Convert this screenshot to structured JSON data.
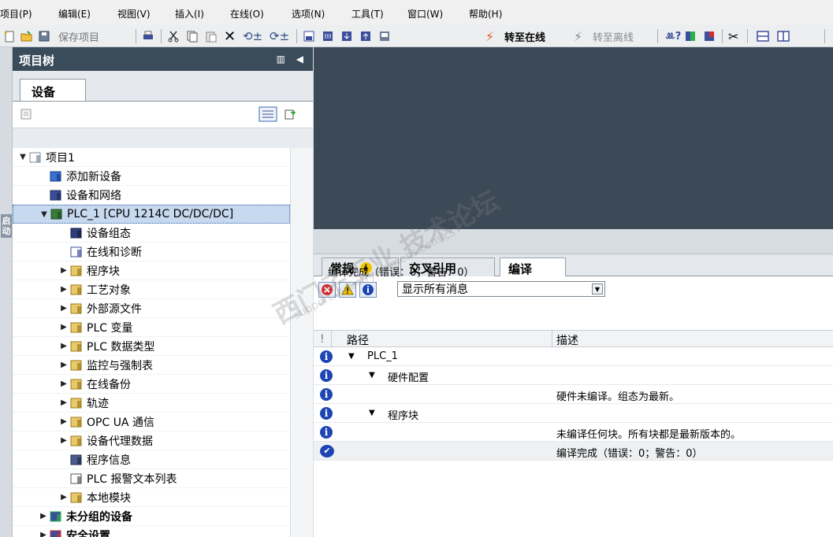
{
  "menu": [
    "项目(P)",
    "编辑(E)",
    "视图(V)",
    "插入(I)",
    "在线(O)",
    "选项(N)",
    "工具(T)",
    "窗口(W)",
    "帮助(H)"
  ],
  "toolbar": {
    "save_project": "保存项目",
    "go_online": "转至在线",
    "go_offline": "转至离线"
  },
  "left_strip_label": "启动",
  "project_tree": {
    "title": "项目树",
    "tab": "设备",
    "items": [
      {
        "label": "项目1",
        "icon": "project-icon",
        "level": 0,
        "expand": "open"
      },
      {
        "label": "添加新设备",
        "icon": "add-device-icon",
        "level": 1,
        "expand": "none"
      },
      {
        "label": "设备和网络",
        "icon": "network-icon",
        "level": 1,
        "expand": "none"
      },
      {
        "label": "PLC_1 [CPU 1214C DC/DC/DC]",
        "icon": "plc-icon",
        "level": 1,
        "expand": "open",
        "selected": true
      },
      {
        "label": "设备组态",
        "icon": "device-config-icon",
        "level": 2,
        "expand": "none"
      },
      {
        "label": "在线和诊断",
        "icon": "diagnostics-icon",
        "level": 2,
        "expand": "none"
      },
      {
        "label": "程序块",
        "icon": "folder-icon",
        "level": 2,
        "expand": "closed"
      },
      {
        "label": "工艺对象",
        "icon": "folder-icon",
        "level": 2,
        "expand": "closed"
      },
      {
        "label": "外部源文件",
        "icon": "folder-icon",
        "level": 2,
        "expand": "closed"
      },
      {
        "label": "PLC 变量",
        "icon": "folder-icon",
        "level": 2,
        "expand": "closed"
      },
      {
        "label": "PLC 数据类型",
        "icon": "folder-icon",
        "level": 2,
        "expand": "closed"
      },
      {
        "label": "监控与强制表",
        "icon": "folder-icon",
        "level": 2,
        "expand": "closed"
      },
      {
        "label": "在线备份",
        "icon": "folder-icon",
        "level": 2,
        "expand": "closed"
      },
      {
        "label": "轨迹",
        "icon": "folder-icon",
        "level": 2,
        "expand": "closed"
      },
      {
        "label": "OPC UA 通信",
        "icon": "folder-icon",
        "level": 2,
        "expand": "closed"
      },
      {
        "label": "设备代理数据",
        "icon": "folder-icon",
        "level": 2,
        "expand": "closed"
      },
      {
        "label": "程序信息",
        "icon": "program-info-icon",
        "level": 2,
        "expand": "none"
      },
      {
        "label": "PLC 报警文本列表",
        "icon": "alarm-text-icon",
        "level": 2,
        "expand": "none"
      },
      {
        "label": "本地模块",
        "icon": "folder-icon",
        "level": 2,
        "expand": "closed"
      },
      {
        "label": "未分组的设备",
        "icon": "ungrouped-icon",
        "level": 1,
        "expand": "closed",
        "bold": true
      },
      {
        "label": "安全设置",
        "icon": "security-icon",
        "level": 1,
        "expand": "closed",
        "bold": true
      }
    ]
  },
  "inspector": {
    "tabs": [
      {
        "label": "常规",
        "badge": "i"
      },
      {
        "label": "交叉引用"
      },
      {
        "label": "编译",
        "active": true
      }
    ],
    "filter_value": "显示所有消息",
    "summary": "编译完成（错误：0；警告：0）",
    "columns": {
      "path": "路径",
      "description": "描述",
      "status_col": "!"
    },
    "rows": [
      {
        "icon": "info-icon",
        "path": "PLC_1",
        "indent": 0,
        "expand": "open",
        "desc": ""
      },
      {
        "icon": "info-icon",
        "path": "硬件配置",
        "indent": 1,
        "expand": "open",
        "desc": ""
      },
      {
        "icon": "info-icon",
        "path": "",
        "indent": 2,
        "expand": "none",
        "desc": "硬件未编译。组态为最新。"
      },
      {
        "icon": "info-icon",
        "path": "程序块",
        "indent": 1,
        "expand": "open",
        "desc": ""
      },
      {
        "icon": "info-icon",
        "path": "",
        "indent": 2,
        "expand": "none",
        "desc": "未编译任何块。所有块都是最新版本的。"
      },
      {
        "icon": "success-icon",
        "path": "",
        "indent": 0,
        "expand": "none",
        "desc": "编译完成（错误：0；警告：0）"
      }
    ]
  },
  "watermark": {
    "main": "西门子工业  技术论坛",
    "sub": "support.industry.siemens.com/cs"
  }
}
